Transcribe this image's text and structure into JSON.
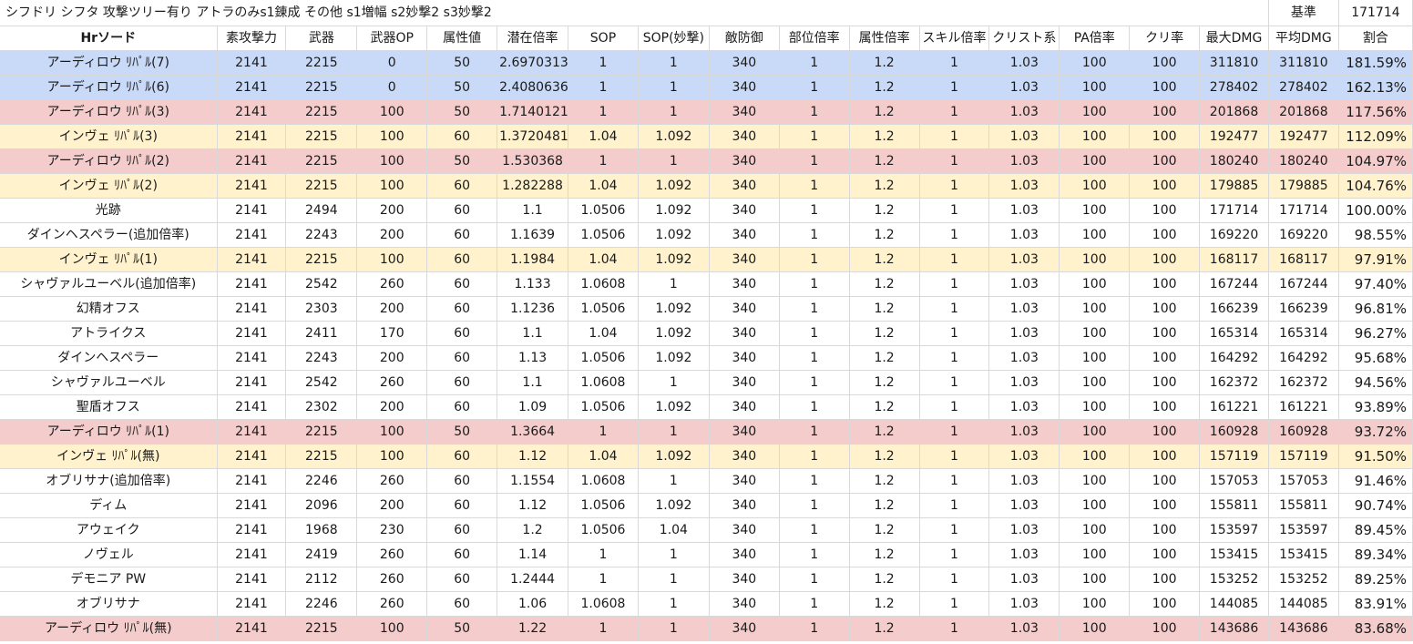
{
  "title": "シフドリ シフタ 攻撃ツリー有り アトラのみs1錬成 その他 s1増幅 s2妙撃2 s3妙撃2",
  "baseline_label": "基準",
  "baseline_value": "171714",
  "columns": [
    "Hrソード",
    "素攻撃力",
    "武器",
    "武器OP",
    "属性値",
    "潜在倍率",
    "SOP",
    "SOP(妙撃)",
    "敵防御",
    "部位倍率",
    "属性倍率",
    "スキル倍率",
    "クリスト系",
    "PA倍率",
    "クリ率",
    "最大DMG",
    "平均DMG",
    "割合"
  ],
  "colors": {
    "blue": "#c9daf8",
    "pink": "#f4cccc",
    "yellow": "#fff2cc",
    "white": "#ffffff",
    "grid": "#d9d9d9"
  },
  "rows": [
    {
      "color": "blue",
      "cells": [
        "アーディロウ ﾘﾊﾟﾙ(7)",
        "2141",
        "2215",
        "0",
        "50",
        "2.6970313",
        "1",
        "1",
        "340",
        "1",
        "1.2",
        "1",
        "1.03",
        "100",
        "100",
        "311810",
        "311810",
        "181.59%"
      ]
    },
    {
      "color": "blue",
      "cells": [
        "アーディロウ ﾘﾊﾟﾙ(6)",
        "2141",
        "2215",
        "0",
        "50",
        "2.4080636",
        "1",
        "1",
        "340",
        "1",
        "1.2",
        "1",
        "1.03",
        "100",
        "100",
        "278402",
        "278402",
        "162.13%"
      ]
    },
    {
      "color": "pink",
      "cells": [
        "アーディロウ ﾘﾊﾟﾙ(3)",
        "2141",
        "2215",
        "100",
        "50",
        "1.7140121€",
        "1",
        "1",
        "340",
        "1",
        "1.2",
        "1",
        "1.03",
        "100",
        "100",
        "201868",
        "201868",
        "117.56%"
      ]
    },
    {
      "color": "yellow",
      "cells": [
        "インヴェ ﾘﾊﾟﾙ(3)",
        "2141",
        "2215",
        "100",
        "60",
        "1.3720481€",
        "1.04",
        "1.092",
        "340",
        "1",
        "1.2",
        "1",
        "1.03",
        "100",
        "100",
        "192477",
        "192477",
        "112.09%"
      ]
    },
    {
      "color": "pink",
      "cells": [
        "アーディロウ ﾘﾊﾟﾙ(2)",
        "2141",
        "2215",
        "100",
        "50",
        "1.530368",
        "1",
        "1",
        "340",
        "1",
        "1.2",
        "1",
        "1.03",
        "100",
        "100",
        "180240",
        "180240",
        "104.97%"
      ]
    },
    {
      "color": "yellow",
      "cells": [
        "インヴェ ﾘﾊﾟﾙ(2)",
        "2141",
        "2215",
        "100",
        "60",
        "1.282288",
        "1.04",
        "1.092",
        "340",
        "1",
        "1.2",
        "1",
        "1.03",
        "100",
        "100",
        "179885",
        "179885",
        "104.76%"
      ]
    },
    {
      "color": "white",
      "cells": [
        "光跡",
        "2141",
        "2494",
        "200",
        "60",
        "1.1",
        "1.0506",
        "1.092",
        "340",
        "1",
        "1.2",
        "1",
        "1.03",
        "100",
        "100",
        "171714",
        "171714",
        "100.00%"
      ]
    },
    {
      "color": "white",
      "cells": [
        "ダインヘスペラー(追加倍率)",
        "2141",
        "2243",
        "200",
        "60",
        "1.1639",
        "1.0506",
        "1.092",
        "340",
        "1",
        "1.2",
        "1",
        "1.03",
        "100",
        "100",
        "169220",
        "169220",
        "98.55%"
      ]
    },
    {
      "color": "yellow",
      "cells": [
        "インヴェ ﾘﾊﾟﾙ(1)",
        "2141",
        "2215",
        "100",
        "60",
        "1.1984",
        "1.04",
        "1.092",
        "340",
        "1",
        "1.2",
        "1",
        "1.03",
        "100",
        "100",
        "168117",
        "168117",
        "97.91%"
      ]
    },
    {
      "color": "white",
      "cells": [
        "シャヴァルユーベル(追加倍率)",
        "2141",
        "2542",
        "260",
        "60",
        "1.133",
        "1.0608",
        "1",
        "340",
        "1",
        "1.2",
        "1",
        "1.03",
        "100",
        "100",
        "167244",
        "167244",
        "97.40%"
      ]
    },
    {
      "color": "white",
      "cells": [
        "幻精オフス",
        "2141",
        "2303",
        "200",
        "60",
        "1.1236",
        "1.0506",
        "1.092",
        "340",
        "1",
        "1.2",
        "1",
        "1.03",
        "100",
        "100",
        "166239",
        "166239",
        "96.81%"
      ]
    },
    {
      "color": "white",
      "cells": [
        "アトライクス",
        "2141",
        "2411",
        "170",
        "60",
        "1.1",
        "1.04",
        "1.092",
        "340",
        "1",
        "1.2",
        "1",
        "1.03",
        "100",
        "100",
        "165314",
        "165314",
        "96.27%"
      ]
    },
    {
      "color": "white",
      "cells": [
        "ダインヘスペラー",
        "2141",
        "2243",
        "200",
        "60",
        "1.13",
        "1.0506",
        "1.092",
        "340",
        "1",
        "1.2",
        "1",
        "1.03",
        "100",
        "100",
        "164292",
        "164292",
        "95.68%"
      ]
    },
    {
      "color": "white",
      "cells": [
        "シャヴァルユーベル",
        "2141",
        "2542",
        "260",
        "60",
        "1.1",
        "1.0608",
        "1",
        "340",
        "1",
        "1.2",
        "1",
        "1.03",
        "100",
        "100",
        "162372",
        "162372",
        "94.56%"
      ]
    },
    {
      "color": "white",
      "cells": [
        "聖盾オフス",
        "2141",
        "2302",
        "200",
        "60",
        "1.09",
        "1.0506",
        "1.092",
        "340",
        "1",
        "1.2",
        "1",
        "1.03",
        "100",
        "100",
        "161221",
        "161221",
        "93.89%"
      ]
    },
    {
      "color": "pink",
      "cells": [
        "アーディロウ ﾘﾊﾟﾙ(1)",
        "2141",
        "2215",
        "100",
        "50",
        "1.3664",
        "1",
        "1",
        "340",
        "1",
        "1.2",
        "1",
        "1.03",
        "100",
        "100",
        "160928",
        "160928",
        "93.72%"
      ]
    },
    {
      "color": "yellow",
      "cells": [
        "インヴェ ﾘﾊﾟﾙ(無)",
        "2141",
        "2215",
        "100",
        "60",
        "1.12",
        "1.04",
        "1.092",
        "340",
        "1",
        "1.2",
        "1",
        "1.03",
        "100",
        "100",
        "157119",
        "157119",
        "91.50%"
      ]
    },
    {
      "color": "white",
      "cells": [
        "オブリサナ(追加倍率)",
        "2141",
        "2246",
        "260",
        "60",
        "1.1554",
        "1.0608",
        "1",
        "340",
        "1",
        "1.2",
        "1",
        "1.03",
        "100",
        "100",
        "157053",
        "157053",
        "91.46%"
      ]
    },
    {
      "color": "white",
      "cells": [
        "ディム",
        "2141",
        "2096",
        "200",
        "60",
        "1.12",
        "1.0506",
        "1.092",
        "340",
        "1",
        "1.2",
        "1",
        "1.03",
        "100",
        "100",
        "155811",
        "155811",
        "90.74%"
      ]
    },
    {
      "color": "white",
      "cells": [
        "アウェイク",
        "2141",
        "1968",
        "230",
        "60",
        "1.2",
        "1.0506",
        "1.04",
        "340",
        "1",
        "1.2",
        "1",
        "1.03",
        "100",
        "100",
        "153597",
        "153597",
        "89.45%"
      ]
    },
    {
      "color": "white",
      "cells": [
        "ノヴェル",
        "2141",
        "2419",
        "260",
        "60",
        "1.14",
        "1",
        "1",
        "340",
        "1",
        "1.2",
        "1",
        "1.03",
        "100",
        "100",
        "153415",
        "153415",
        "89.34%"
      ]
    },
    {
      "color": "white",
      "cells": [
        "デモニア PW",
        "2141",
        "2112",
        "260",
        "60",
        "1.2444",
        "1",
        "1",
        "340",
        "1",
        "1.2",
        "1",
        "1.03",
        "100",
        "100",
        "153252",
        "153252",
        "89.25%"
      ]
    },
    {
      "color": "white",
      "cells": [
        "オブリサナ",
        "2141",
        "2246",
        "260",
        "60",
        "1.06",
        "1.0608",
        "1",
        "340",
        "1",
        "1.2",
        "1",
        "1.03",
        "100",
        "100",
        "144085",
        "144085",
        "83.91%"
      ]
    },
    {
      "color": "pink",
      "cells": [
        "アーディロウ ﾘﾊﾟﾙ(無)",
        "2141",
        "2215",
        "100",
        "50",
        "1.22",
        "1",
        "1",
        "340",
        "1",
        "1.2",
        "1",
        "1.03",
        "100",
        "100",
        "143686",
        "143686",
        "83.68%"
      ]
    }
  ]
}
